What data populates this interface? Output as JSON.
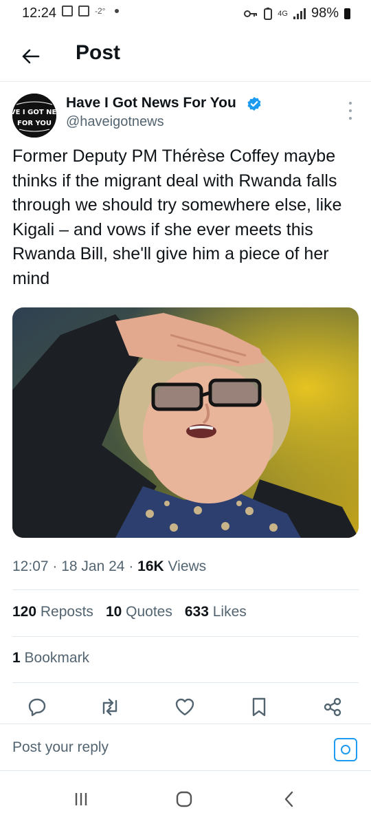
{
  "status_bar": {
    "time": "12:24",
    "temperature": "-2°",
    "network": "4G",
    "battery": "98%"
  },
  "header": {
    "title": "Post"
  },
  "post": {
    "author_name": "Have I Got News For You",
    "handle": "@haveigotnews",
    "avatar_text": "HAVE I GOT NEWS FOR YOU",
    "text": "Former Deputy PM Thérèse Coffey maybe thinks if the migrant deal with Rwanda falls through we should try somewhere else, like Kigali – and vows if she ever meets this Rwanda Bill, she'll give him a piece of her mind",
    "time": "12:07",
    "date": "18 Jan 24",
    "views": "16K",
    "views_label": "Views",
    "reposts": "120",
    "reposts_label": "Reposts",
    "quotes": "10",
    "quotes_label": "Quotes",
    "likes": "633",
    "likes_label": "Likes",
    "bookmarks": "1",
    "bookmarks_label": "Bookmark"
  },
  "reply": {
    "placeholder": "Post your reply"
  },
  "icons": {
    "back": "arrow-left-icon",
    "verified": "verified-badge-icon",
    "more": "more-vertical-icon",
    "reply": "reply-icon",
    "repost": "repost-icon",
    "like": "heart-icon",
    "bookmark": "bookmark-icon",
    "share": "share-icon",
    "camera": "camera-icon"
  },
  "colors": {
    "accent": "#1d9bf0",
    "text": "#0f1419",
    "secondary": "#536471"
  }
}
